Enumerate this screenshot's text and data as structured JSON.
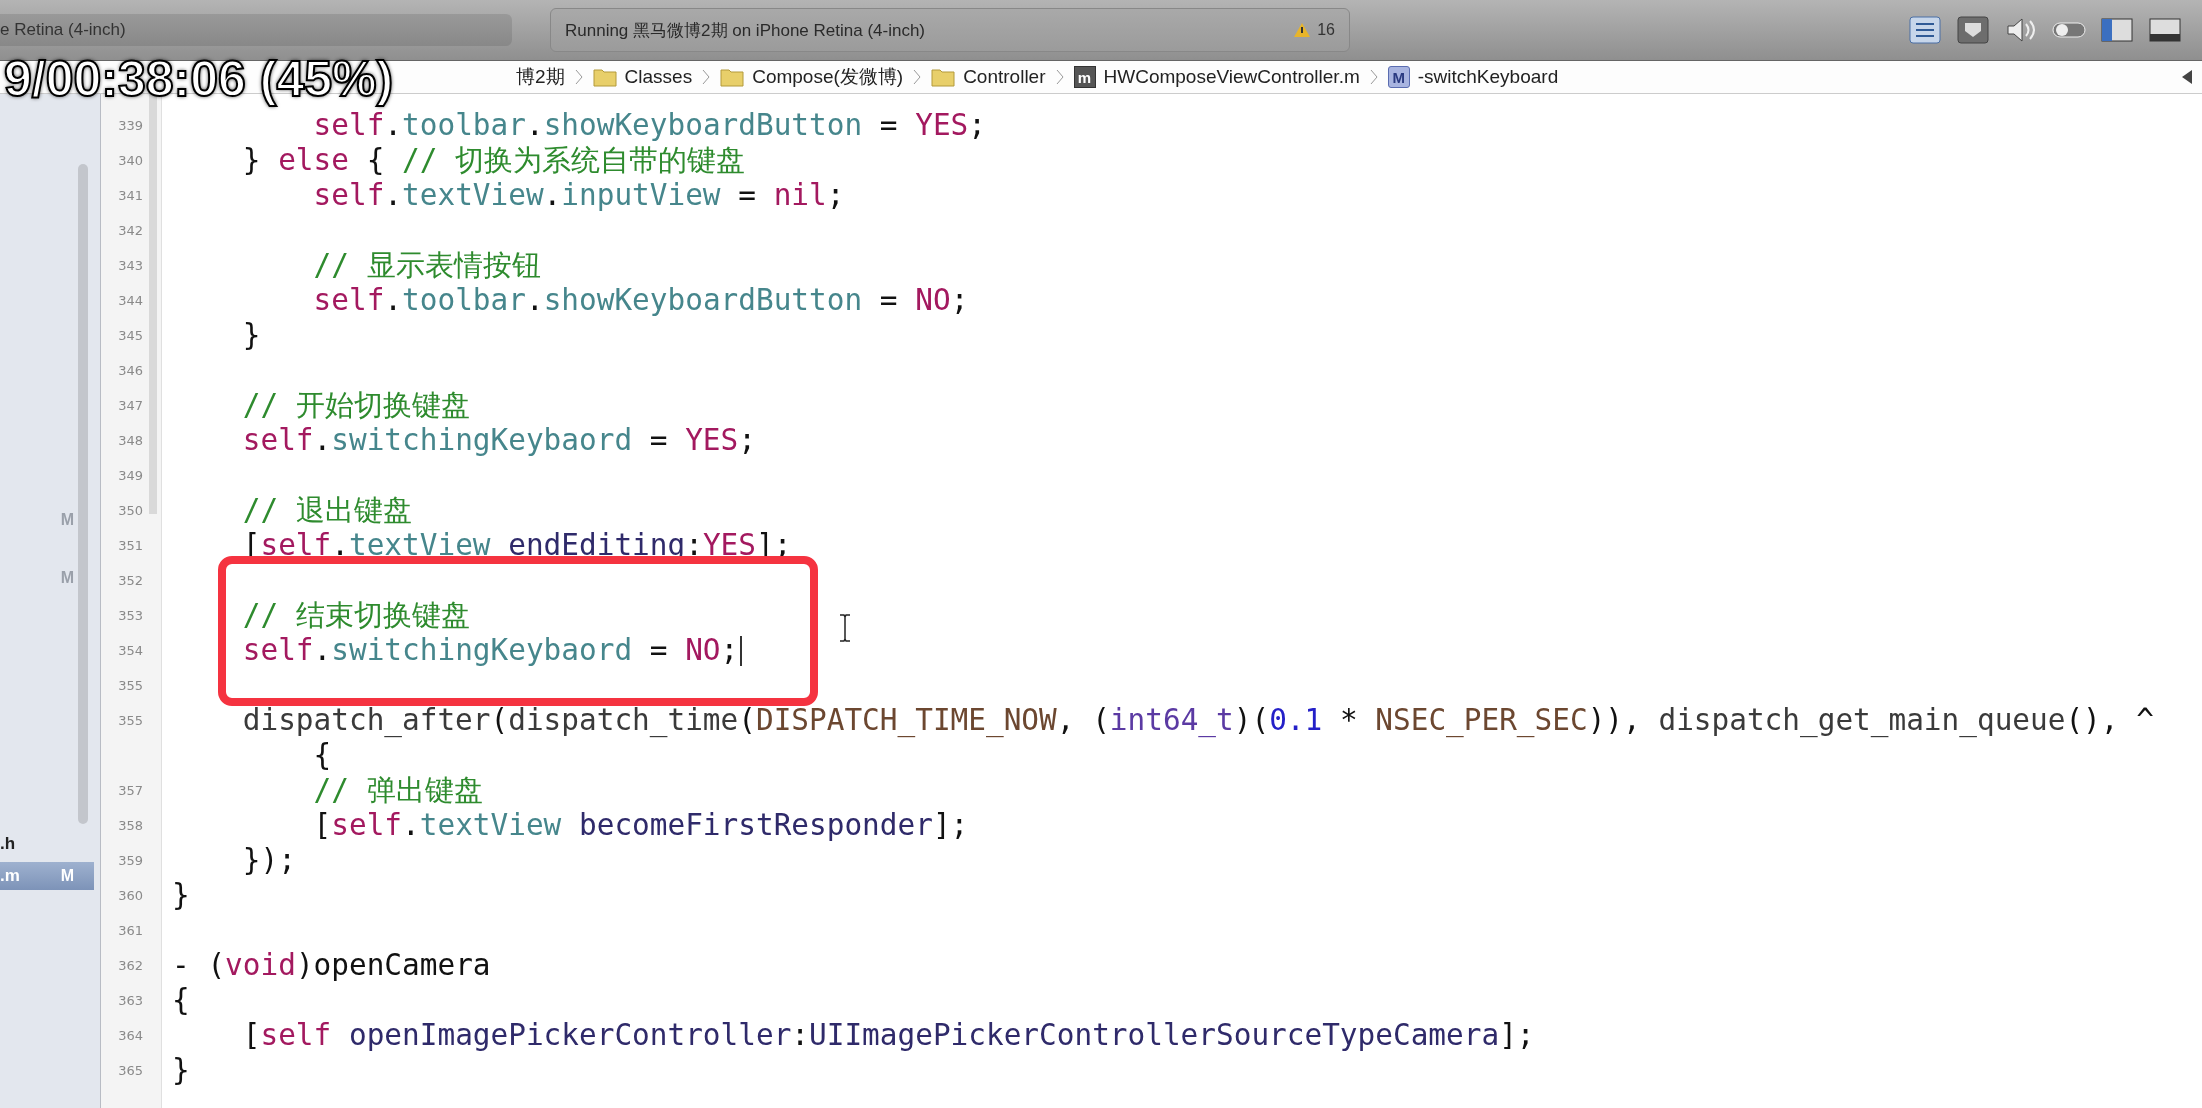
{
  "toolbar": {
    "scheme": "e Retina (4-inch)",
    "activity": "Running 黑马微博2期 on iPhone Retina (4-inch)",
    "warnings": "16"
  },
  "video_overlay": {
    "time": "9/00:38:06 (45%)"
  },
  "breadcrumb": [
    {
      "kind": "text",
      "label": "博2期"
    },
    {
      "kind": "folder",
      "label": "Classes"
    },
    {
      "kind": "folder",
      "label": "Compose(发微博)"
    },
    {
      "kind": "folder",
      "label": "Controller"
    },
    {
      "kind": "file",
      "icon_text": "m",
      "label": "HWComposeViewController.m"
    },
    {
      "kind": "method",
      "icon_text": "M",
      "label": "-switchKeyboard"
    }
  ],
  "navigator": {
    "items": [
      {
        "badge": "M",
        "selected": false
      },
      {
        "badge": "M",
        "selected": false
      },
      {
        "name": ".h",
        "selected": false
      },
      {
        "name": ".m",
        "badge": "M",
        "selected": true
      }
    ]
  },
  "editor": {
    "lines": [
      {
        "number": "339",
        "cursor": false,
        "tokens": [
          {
            "kind": "keyword",
            "text": "        self"
          },
          {
            "kind": "plain",
            "text": "."
          },
          {
            "kind": "property",
            "text": "toolbar"
          },
          {
            "kind": "plain",
            "text": "."
          },
          {
            "kind": "property",
            "text": "showKeyboardButton"
          },
          {
            "kind": "plain",
            "text": " = "
          },
          {
            "kind": "keyword",
            "text": "YES"
          },
          {
            "kind": "plain",
            "text": ";"
          }
        ]
      },
      {
        "number": "340",
        "cursor": false,
        "tokens": [
          {
            "kind": "plain",
            "text": "    } "
          },
          {
            "kind": "keyword",
            "text": "else"
          },
          {
            "kind": "plain",
            "text": " { "
          },
          {
            "kind": "comment",
            "text": "// 切换为系统自带的键盘"
          }
        ]
      },
      {
        "number": "341",
        "cursor": false,
        "tokens": [
          {
            "kind": "keyword",
            "text": "        self"
          },
          {
            "kind": "plain",
            "text": "."
          },
          {
            "kind": "property",
            "text": "textView"
          },
          {
            "kind": "plain",
            "text": "."
          },
          {
            "kind": "property",
            "text": "inputView"
          },
          {
            "kind": "plain",
            "text": " = "
          },
          {
            "kind": "keyword",
            "text": "nil"
          },
          {
            "kind": "plain",
            "text": ";"
          }
        ]
      },
      {
        "number": "342",
        "cursor": false
      },
      {
        "number": "343",
        "cursor": false,
        "tokens": [
          {
            "kind": "comment",
            "text": "        // 显示表情按钮"
          }
        ]
      },
      {
        "number": "344",
        "cursor": false,
        "tokens": [
          {
            "kind": "keyword",
            "text": "        self"
          },
          {
            "kind": "plain",
            "text": "."
          },
          {
            "kind": "property",
            "text": "toolbar"
          },
          {
            "kind": "plain",
            "text": "."
          },
          {
            "kind": "property",
            "text": "showKeyboardButton"
          },
          {
            "kind": "plain",
            "text": " = "
          },
          {
            "kind": "keyword",
            "text": "NO"
          },
          {
            "kind": "plain",
            "text": ";"
          }
        ]
      },
      {
        "number": "345",
        "cursor": false,
        "tokens": [
          {
            "kind": "plain",
            "text": "    }"
          }
        ]
      },
      {
        "number": "346",
        "cursor": false
      },
      {
        "number": "347",
        "cursor": false,
        "tokens": [
          {
            "kind": "comment",
            "text": "    // 开始切换键盘"
          }
        ]
      },
      {
        "number": "348",
        "cursor": false,
        "tokens": [
          {
            "kind": "keyword",
            "text": "    self"
          },
          {
            "kind": "plain",
            "text": "."
          },
          {
            "kind": "property",
            "text": "switchingKeybaord"
          },
          {
            "kind": "plain",
            "text": " = "
          },
          {
            "kind": "keyword",
            "text": "YES"
          },
          {
            "kind": "plain",
            "text": ";"
          }
        ]
      },
      {
        "number": "349",
        "cursor": false
      },
      {
        "number": "350",
        "cursor": false,
        "tokens": [
          {
            "kind": "comment",
            "text": "    // 退出键盘"
          }
        ]
      },
      {
        "number": "351",
        "cursor": false,
        "tokens": [
          {
            "kind": "plain",
            "text": "    ["
          },
          {
            "kind": "keyword",
            "text": "self"
          },
          {
            "kind": "plain",
            "text": "."
          },
          {
            "kind": "property",
            "text": "textView"
          },
          {
            "kind": "method",
            "text": " endEditing"
          },
          {
            "kind": "plain",
            "text": ":"
          },
          {
            "kind": "keyword",
            "text": "YES"
          },
          {
            "kind": "plain",
            "text": "];"
          }
        ]
      },
      {
        "number": "352",
        "cursor": false
      },
      {
        "number": "353",
        "cursor": false,
        "tokens": [
          {
            "kind": "comment",
            "text": "    // 结束切换键盘"
          }
        ]
      },
      {
        "number": "354",
        "cursor": true,
        "tokens": [
          {
            "kind": "keyword",
            "text": "    self"
          },
          {
            "kind": "plain",
            "text": "."
          },
          {
            "kind": "property",
            "text": "switchingKeybaord"
          },
          {
            "kind": "plain",
            "text": " = "
          },
          {
            "kind": "keyword",
            "text": "NO"
          },
          {
            "kind": "plain",
            "text": ";"
          }
        ]
      },
      {
        "number": "355",
        "cursor": false
      },
      {
        "number": "355",
        "cursor": false,
        "tokens": [
          {
            "kind": "func",
            "text": "    dispatch_after"
          },
          {
            "kind": "plain",
            "text": "("
          },
          {
            "kind": "func",
            "text": "dispatch_time"
          },
          {
            "kind": "plain",
            "text": "("
          },
          {
            "kind": "macro",
            "text": "DISPATCH_TIME_NOW"
          },
          {
            "kind": "plain",
            "text": ", ("
          },
          {
            "kind": "type",
            "text": "int64_t"
          },
          {
            "kind": "plain",
            "text": ")("
          },
          {
            "kind": "number",
            "text": "0.1"
          },
          {
            "kind": "plain",
            "text": " * "
          },
          {
            "kind": "macro",
            "text": "NSEC_PER_SEC"
          },
          {
            "kind": "plain",
            "text": ")), "
          },
          {
            "kind": "func",
            "text": "dispatch_get_main_queue"
          },
          {
            "kind": "plain",
            "text": "(), ^"
          }
        ]
      },
      {
        "cursor": false,
        "tokens": [
          {
            "kind": "plain",
            "text": "        {"
          }
        ]
      },
      {
        "number": "357",
        "cursor": false,
        "tokens": [
          {
            "kind": "comment",
            "text": "        // 弹出键盘"
          }
        ]
      },
      {
        "number": "358",
        "cursor": false,
        "tokens": [
          {
            "kind": "plain",
            "text": "        ["
          },
          {
            "kind": "keyword",
            "text": "self"
          },
          {
            "kind": "plain",
            "text": "."
          },
          {
            "kind": "property",
            "text": "textView"
          },
          {
            "kind": "method",
            "text": " becomeFirstResponder"
          },
          {
            "kind": "plain",
            "text": "];"
          }
        ]
      },
      {
        "number": "359",
        "cursor": false,
        "tokens": [
          {
            "kind": "plain",
            "text": "    });"
          }
        ]
      },
      {
        "number": "360",
        "cursor": false,
        "tokens": [
          {
            "kind": "plain",
            "text": "}"
          }
        ]
      },
      {
        "number": "361",
        "cursor": false
      },
      {
        "number": "362",
        "cursor": false,
        "tokens": [
          {
            "kind": "plain",
            "text": "- ("
          },
          {
            "kind": "keyword",
            "text": "void"
          },
          {
            "kind": "plain",
            "text": ")openCamera"
          }
        ]
      },
      {
        "number": "363",
        "cursor": false,
        "tokens": [
          {
            "kind": "plain",
            "text": "{"
          }
        ]
      },
      {
        "number": "364",
        "cursor": false,
        "tokens": [
          {
            "kind": "plain",
            "text": "    ["
          },
          {
            "kind": "keyword",
            "text": "self"
          },
          {
            "kind": "method",
            "text": " openImagePickerController"
          },
          {
            "kind": "plain",
            "text": ":"
          },
          {
            "kind": "method",
            "text": "UIImagePickerControllerSourceTypeCamera"
          },
          {
            "kind": "plain",
            "text": "];"
          }
        ]
      },
      {
        "number": "365",
        "cursor": false,
        "tokens": [
          {
            "kind": "plain",
            "text": "}"
          }
        ]
      }
    ]
  }
}
